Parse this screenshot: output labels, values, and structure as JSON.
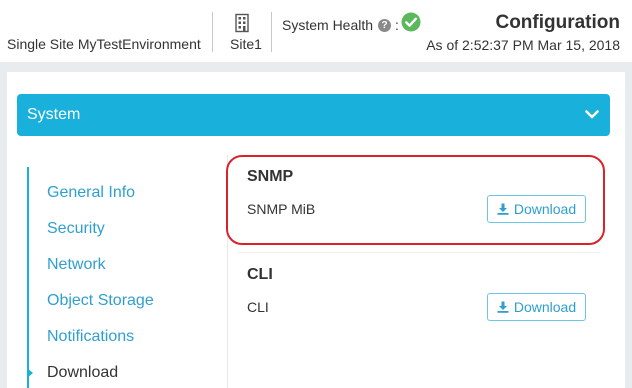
{
  "header": {
    "environment_name": "Single Site MyTestEnvironment",
    "site_name": "Site1",
    "health_label": "System Health",
    "health_colon": ":",
    "help_glyph": "?",
    "title": "Configuration",
    "as_of": "As of 2:52:37 PM Mar 15, 2018",
    "icons": {
      "site": "building-icon",
      "help": "question-circle-icon",
      "health_status": "check-circle-icon"
    },
    "colors": {
      "health_ok": "#5cb85c"
    }
  },
  "system_bar": {
    "label": "System",
    "icon": "chevron-down-icon",
    "color": "#1ab0dc"
  },
  "nav": {
    "items": [
      {
        "label": "General Info",
        "active": false
      },
      {
        "label": "Security",
        "active": false
      },
      {
        "label": "Network",
        "active": false
      },
      {
        "label": "Object Storage",
        "active": false
      },
      {
        "label": "Notifications",
        "active": false
      },
      {
        "label": "Download",
        "active": true
      }
    ]
  },
  "sections": [
    {
      "title": "SNMP",
      "item": "SNMP MiB",
      "button_label": "Download",
      "button_icon": "download-icon",
      "highlighted": true
    },
    {
      "title": "CLI",
      "item": "CLI",
      "button_label": "Download",
      "button_icon": "download-icon",
      "highlighted": false
    }
  ],
  "colors": {
    "accent": "#1ab0dc",
    "link": "#2f9fd0",
    "highlight_border": "#d8232a"
  }
}
